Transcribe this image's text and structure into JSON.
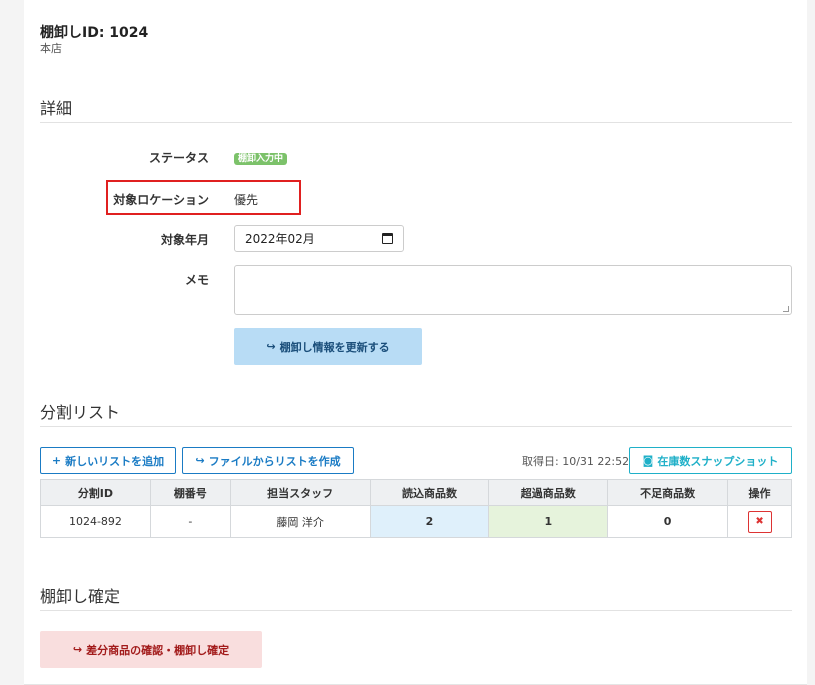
{
  "header": {
    "title": "棚卸しID: 1024",
    "subtitle": "本店"
  },
  "details": {
    "section_title": "詳細",
    "status_label": "ステータス",
    "status_badge": "棚卸入力中",
    "location_label": "対象ロケーション",
    "location_value": "優先",
    "month_label": "対象年月",
    "month_value": "2022年02月",
    "memo_label": "メモ",
    "memo_value": "",
    "update_button": "棚卸し情報を更新する"
  },
  "split_list": {
    "section_title": "分割リスト",
    "add_button": "新しいリストを追加",
    "file_button": "ファイルからリストを作成",
    "fetched_at": "取得日: 10/31 22:52",
    "snapshot_button": "在庫数スナップショット",
    "columns": [
      "分割ID",
      "棚番号",
      "担当スタッフ",
      "読込商品数",
      "超過商品数",
      "不足商品数",
      "操作"
    ],
    "rows": [
      {
        "id": "1024-892",
        "shelf": "-",
        "staff": "藤岡 洋介",
        "read": "2",
        "over": "1",
        "short": "0"
      }
    ]
  },
  "confirm": {
    "section_title": "棚卸し確定",
    "confirm_button": "差分商品の確認・棚卸し確定"
  },
  "colors": {
    "accent": "#1a7bc4",
    "teal": "#1fb0c8",
    "badge": "#7cc26a",
    "danger": "#d33333",
    "highlight": "#e02020"
  }
}
